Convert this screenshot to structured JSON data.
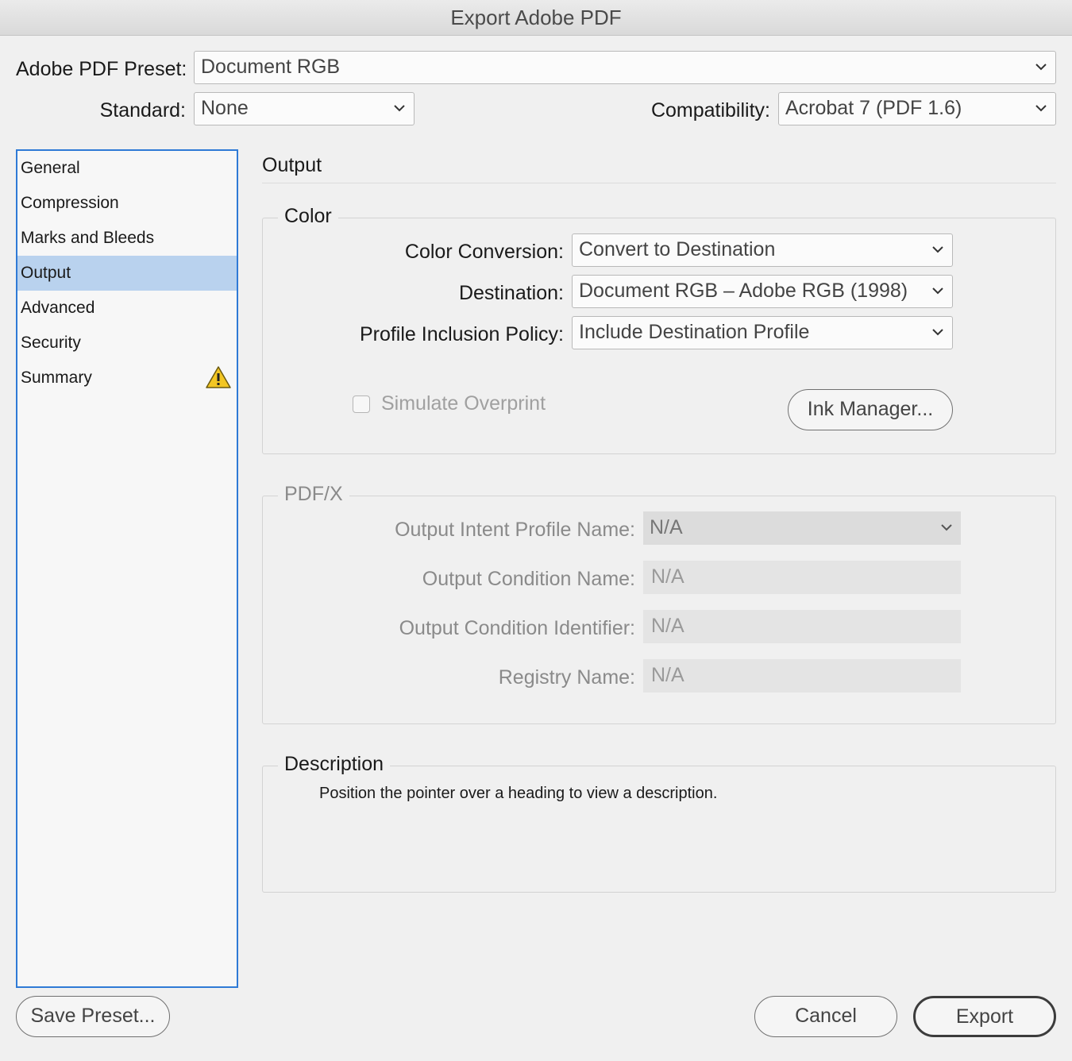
{
  "window": {
    "title": "Export Adobe PDF"
  },
  "preset": {
    "label": "Adobe PDF Preset:",
    "value": "Document RGB"
  },
  "standard": {
    "label": "Standard:",
    "value": "None"
  },
  "compatibility": {
    "label": "Compatibility:",
    "value": "Acrobat 7 (PDF 1.6)"
  },
  "sidebar": {
    "items": [
      {
        "label": "General"
      },
      {
        "label": "Compression"
      },
      {
        "label": "Marks and Bleeds"
      },
      {
        "label": "Output"
      },
      {
        "label": "Advanced"
      },
      {
        "label": "Security"
      },
      {
        "label": "Summary"
      }
    ],
    "selected": "Output"
  },
  "panel": {
    "title": "Output"
  },
  "color": {
    "title": "Color",
    "conversion_label": "Color Conversion:",
    "conversion_value": "Convert to Destination",
    "destination_label": "Destination:",
    "destination_value": "Document RGB – Adobe RGB (1998)",
    "profile_label": "Profile Inclusion Policy:",
    "profile_value": "Include Destination Profile",
    "simulate_label": "Simulate Overprint",
    "simulate_checked": false,
    "ink_manager_label": "Ink Manager..."
  },
  "pdfx": {
    "title": "PDF/X",
    "intent_label": "Output Intent Profile Name:",
    "intent_value": "N/A",
    "condition_name_label": "Output Condition Name:",
    "condition_name_value": "N/A",
    "condition_id_label": "Output Condition Identifier:",
    "condition_id_value": "N/A",
    "registry_label": "Registry Name:",
    "registry_value": "N/A"
  },
  "description": {
    "title": "Description",
    "text": "Position the pointer over a heading to view a description."
  },
  "footer": {
    "save_preset_label": "Save Preset...",
    "cancel_label": "Cancel",
    "export_label": "Export"
  },
  "colors": {
    "sidebar_border": "#2f7ad6",
    "sidebar_selected": "#b9d2ee",
    "warning": "#f3c623"
  },
  "icons": [
    "chevron-down-icon",
    "warning-icon",
    "checkbox"
  ]
}
